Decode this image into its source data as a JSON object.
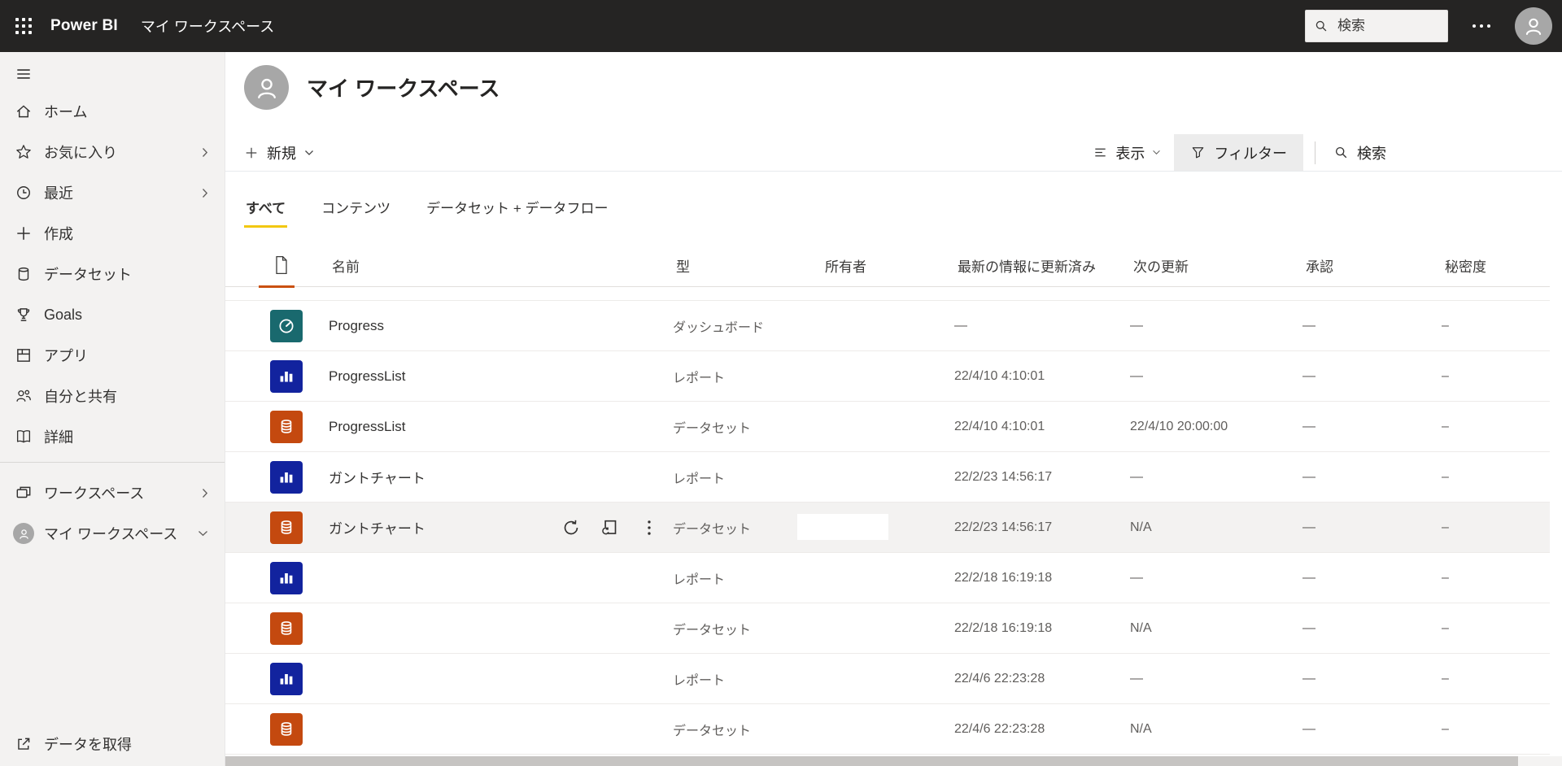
{
  "topbar": {
    "app_name": "Power BI",
    "workspace_label": "マイ ワークスペース",
    "search_placeholder": "検索"
  },
  "sidebar": {
    "items": [
      {
        "label": "ホーム",
        "icon": "home"
      },
      {
        "label": "お気に入り",
        "icon": "star",
        "chevron": "right"
      },
      {
        "label": "最近",
        "icon": "clock",
        "chevron": "right"
      },
      {
        "label": "作成",
        "icon": "plus"
      },
      {
        "label": "データセット",
        "icon": "database"
      },
      {
        "label": "Goals",
        "icon": "trophy"
      },
      {
        "label": "アプリ",
        "icon": "apps"
      },
      {
        "label": "自分と共有",
        "icon": "people"
      },
      {
        "label": "詳細",
        "icon": "book"
      },
      {
        "divider": true
      },
      {
        "label": "ワークスペース",
        "icon": "workspaces",
        "chevron": "right"
      },
      {
        "label": "マイ ワークスペース",
        "icon": "avatar",
        "chevron": "down"
      }
    ],
    "get_data_label": "データを取得"
  },
  "main": {
    "page_title": "マイ ワークスペース",
    "toolbar": {
      "new_label": "新規",
      "view_label": "表示",
      "filter_label": "フィルター",
      "search_label": "検索"
    },
    "tabs": [
      {
        "label": "すべて",
        "active": true
      },
      {
        "label": "コンテンツ",
        "active": false
      },
      {
        "label": "データセット + データフロー",
        "active": false
      }
    ],
    "table": {
      "columns": {
        "name": "名前",
        "type": "型",
        "owner": "所有者",
        "refreshed": "最新の情報に更新済み",
        "next_refresh": "次の更新",
        "endorsement": "承認",
        "sensitivity": "秘密度"
      },
      "hover_actions": [
        "refresh-icon",
        "schedule-refresh-icon",
        "more-options-icon"
      ],
      "rows": [
        {
          "name": "Progress",
          "icon": "dashboard",
          "type": "ダッシュボード",
          "owner": "",
          "refreshed": "—",
          "next_refresh": "—",
          "endorsement": "—",
          "sensitivity": "–",
          "hovered": false,
          "owner_masked": false
        },
        {
          "name": "ProgressList",
          "icon": "report",
          "type": "レポート",
          "owner": "",
          "refreshed": "22/4/10 4:10:01",
          "next_refresh": "—",
          "endorsement": "—",
          "sensitivity": "–",
          "hovered": false,
          "owner_masked": false
        },
        {
          "name": "ProgressList",
          "icon": "dataset",
          "type": "データセット",
          "owner": "",
          "refreshed": "22/4/10 4:10:01",
          "next_refresh": "22/4/10 20:00:00",
          "endorsement": "—",
          "sensitivity": "–",
          "hovered": false,
          "owner_masked": false
        },
        {
          "name": "ガントチャート",
          "icon": "report",
          "type": "レポート",
          "owner": "",
          "refreshed": "22/2/23 14:56:17",
          "next_refresh": "—",
          "endorsement": "—",
          "sensitivity": "–",
          "hovered": false,
          "owner_masked": false
        },
        {
          "name": "ガントチャート",
          "icon": "dataset",
          "type": "データセット",
          "owner": "",
          "refreshed": "22/2/23 14:56:17",
          "next_refresh": "N/A",
          "endorsement": "—",
          "sensitivity": "–",
          "hovered": true,
          "owner_masked": true
        },
        {
          "name": "",
          "icon": "report",
          "type": "レポート",
          "owner": "",
          "refreshed": "22/2/18 16:19:18",
          "next_refresh": "—",
          "endorsement": "—",
          "sensitivity": "–",
          "hovered": false,
          "owner_masked": false
        },
        {
          "name": "",
          "icon": "dataset",
          "type": "データセット",
          "owner": "",
          "refreshed": "22/2/18 16:19:18",
          "next_refresh": "N/A",
          "endorsement": "—",
          "sensitivity": "–",
          "hovered": false,
          "owner_masked": false
        },
        {
          "name": "",
          "icon": "report",
          "type": "レポート",
          "owner": "",
          "refreshed": "22/4/6 22:23:28",
          "next_refresh": "—",
          "endorsement": "—",
          "sensitivity": "–",
          "hovered": false,
          "owner_masked": false
        },
        {
          "name": "",
          "icon": "dataset",
          "type": "データセット",
          "owner": "",
          "refreshed": "22/4/6 22:23:28",
          "next_refresh": "N/A",
          "endorsement": "—",
          "sensitivity": "–",
          "hovered": false,
          "owner_masked": false
        }
      ]
    }
  },
  "colors": {
    "topbar_bg": "#252423",
    "sidebar_bg": "#F3F2F1",
    "accent_yellow": "#F2C811",
    "sort_underline": "#CA5010",
    "tile_dashboard": "#19696E",
    "tile_report": "#12239E",
    "tile_dataset": "#C4490F",
    "hover_row_bg": "#F3F2F1"
  }
}
